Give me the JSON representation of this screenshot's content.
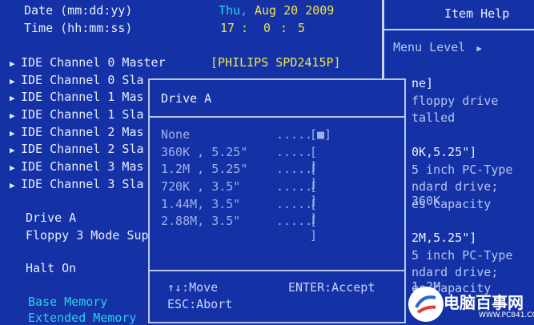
{
  "date": {
    "label": "Date (mm:dd:yy)",
    "day": "Thu,",
    "value": "Aug 20 2009"
  },
  "time": {
    "label": "Time (hh:mm:ss)",
    "h": "17",
    "m": "0",
    "s": "5"
  },
  "ide_items": [
    {
      "label": "IDE Channel 0 Master",
      "value": "[PHILIPS SPD2415P]"
    },
    {
      "label": "IDE Channel 0 Sla"
    },
    {
      "label": "IDE Channel 1 Mas"
    },
    {
      "label": "IDE Channel 1 Sla"
    },
    {
      "label": "IDE Channel 2 Mas"
    },
    {
      "label": "IDE Channel 2 Sla"
    },
    {
      "label": "IDE Channel 3 Mas"
    },
    {
      "label": "IDE Channel 3 Sla"
    }
  ],
  "drive_a": "Drive A",
  "floppy_mode": "Floppy 3 Mode Sup",
  "halt_on": "Halt On",
  "base_memory": "Base Memory",
  "extended_memory": "Extended Memory",
  "help": {
    "title": "Item Help",
    "menu_level": "Menu Level",
    "lines": [
      "ne]",
      "floppy drive",
      "talled",
      "0K,5.25\"]",
      "5 inch PC-Type",
      "ndard drive; 360K",
      "es capacity",
      "2M,5.25\"]",
      "5 inch PC-Type",
      "ndard drive; 1.2M",
      "es capacity"
    ]
  },
  "popup": {
    "title": "Drive A",
    "options": [
      {
        "name": "None",
        "dots": ".....",
        "box": "[■]"
      },
      {
        "name": "360K , 5.25\"",
        "dots": ".....",
        "box": "[ ]"
      },
      {
        "name": "1.2M , 5.25\"",
        "dots": ".....",
        "box": "[ ]"
      },
      {
        "name": "720K , 3.5\"",
        "dots": ".....",
        "box": "[ ]"
      },
      {
        "name": "1.44M, 3.5\"",
        "dots": ".....",
        "box": "[ ]"
      },
      {
        "name": "2.88M, 3.5\"",
        "dots": ".....",
        "box": "[ ]"
      }
    ],
    "move": "↑↓:Move",
    "accept": "ENTER:Accept",
    "abort": "ESC:Abort"
  },
  "watermark": {
    "text": "电脑百事网",
    "url": "WWW.PC841.COM"
  }
}
